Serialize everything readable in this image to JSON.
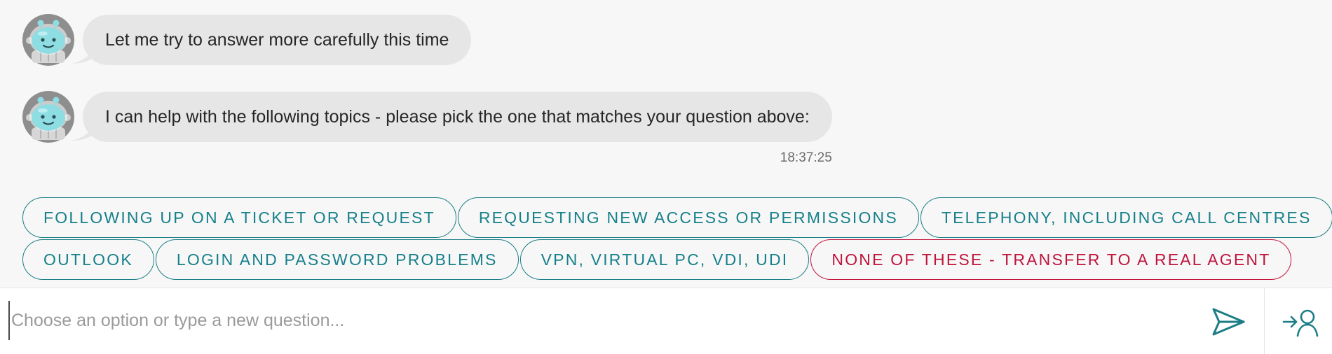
{
  "messages": [
    {
      "text": "Let me try to answer more carefully this time",
      "timestamp": ""
    },
    {
      "text": "I can help with the following topics - please pick the one that matches your question above:",
      "timestamp": "18:37:25"
    }
  ],
  "options": [
    {
      "label": "FOLLOWING UP ON A TICKET OR REQUEST"
    },
    {
      "label": "REQUESTING NEW ACCESS OR PERMISSIONS"
    },
    {
      "label": "TELEPHONY, INCLUDING CALL CENTRES"
    },
    {
      "label": "OUTLOOK"
    },
    {
      "label": "LOGIN AND PASSWORD PROBLEMS"
    },
    {
      "label": "VPN, VIRTUAL PC, VDI, UDI"
    },
    {
      "label": "NONE OF THESE - TRANSFER TO A REAL AGENT"
    }
  ],
  "input": {
    "placeholder": "Choose an option or type a new question...",
    "value": ""
  },
  "icons": {
    "avatar": "robot-avatar-icon",
    "send": "send-icon",
    "agent": "transfer-agent-icon"
  },
  "colors": {
    "accent": "#16808a",
    "agent_option": "#c0143c",
    "bubble": "#e6e6e6",
    "background": "#f7f7f7"
  }
}
